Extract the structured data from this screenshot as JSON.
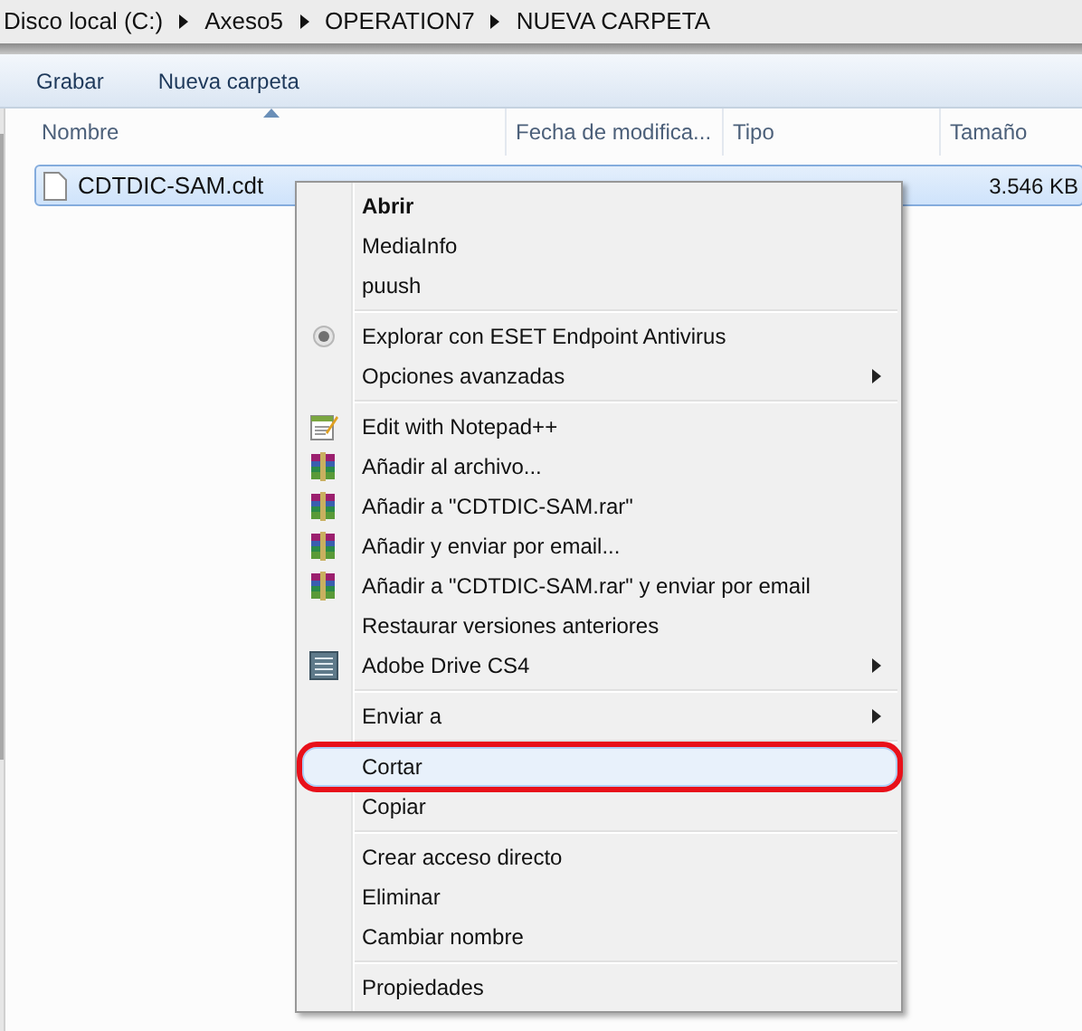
{
  "breadcrumb": [
    "Disco local (C:)",
    "Axeso5",
    "OPERATION7",
    "NUEVA CARPETA"
  ],
  "toolbar": [
    "Grabar",
    "Nueva carpeta"
  ],
  "columns": [
    {
      "label": "Nombre",
      "sorted": true
    },
    {
      "label": "Fecha de modifica...",
      "sorted": false
    },
    {
      "label": "Tipo",
      "sorted": false
    },
    {
      "label": "Tamaño",
      "sorted": false
    }
  ],
  "files": [
    {
      "name": "CDTDIC-SAM.cdt",
      "size": "3.546 KB",
      "selected": true
    }
  ],
  "context_menu": {
    "sections": [
      [
        {
          "label": "Abrir",
          "bold": true,
          "submenu": false,
          "selected": false,
          "circled": false
        },
        {
          "label": "MediaInfo",
          "bold": false,
          "submenu": false,
          "selected": false,
          "circled": false
        },
        {
          "label": "puush",
          "bold": false,
          "submenu": false,
          "selected": false,
          "circled": false
        }
      ],
      [
        {
          "label": "Explorar con ESET Endpoint Antivirus",
          "kind": "radio",
          "bold": false,
          "submenu": false,
          "selected": false,
          "circled": false
        },
        {
          "label": "Opciones avanzadas",
          "bold": false,
          "submenu": true,
          "selected": false,
          "circled": false
        }
      ],
      [
        {
          "label": "Edit with Notepad++",
          "kind": "notepad",
          "bold": false,
          "submenu": false,
          "selected": false,
          "circled": false
        },
        {
          "label": "Añadir al archivo...",
          "kind": "archive",
          "bold": false,
          "submenu": false,
          "selected": false,
          "circled": false
        },
        {
          "label": "Añadir a \"CDTDIC-SAM.rar\"",
          "kind": "archive",
          "bold": false,
          "submenu": false,
          "selected": false,
          "circled": false
        },
        {
          "label": "Añadir y enviar por email...",
          "kind": "archive",
          "bold": false,
          "submenu": false,
          "selected": false,
          "circled": false
        },
        {
          "label": "Añadir a \"CDTDIC-SAM.rar\" y enviar por email",
          "kind": "archive",
          "bold": false,
          "submenu": false,
          "selected": false,
          "circled": false
        },
        {
          "label": "Restaurar versiones anteriores",
          "bold": false,
          "submenu": false,
          "selected": false,
          "circled": false
        },
        {
          "label": "Adobe Drive CS4",
          "kind": "list",
          "bold": false,
          "submenu": true,
          "selected": false,
          "circled": false
        }
      ],
      [
        {
          "label": "Enviar a",
          "bold": false,
          "submenu": true,
          "selected": false,
          "circled": false
        }
      ],
      [
        {
          "label": "Cortar",
          "bold": false,
          "submenu": false,
          "selected": true,
          "circled": true
        },
        {
          "label": "Copiar",
          "bold": false,
          "submenu": false,
          "selected": false,
          "circled": false
        }
      ],
      [
        {
          "label": "Crear acceso directo",
          "bold": false,
          "submenu": false,
          "selected": false,
          "circled": false
        },
        {
          "label": "Eliminar",
          "bold": false,
          "submenu": false,
          "selected": false,
          "circled": false
        },
        {
          "label": "Cambiar nombre",
          "bold": false,
          "submenu": false,
          "selected": false,
          "circled": false
        }
      ],
      [
        {
          "label": "Propiedades",
          "bold": false,
          "submenu": false,
          "selected": false,
          "circled": false
        }
      ]
    ]
  }
}
